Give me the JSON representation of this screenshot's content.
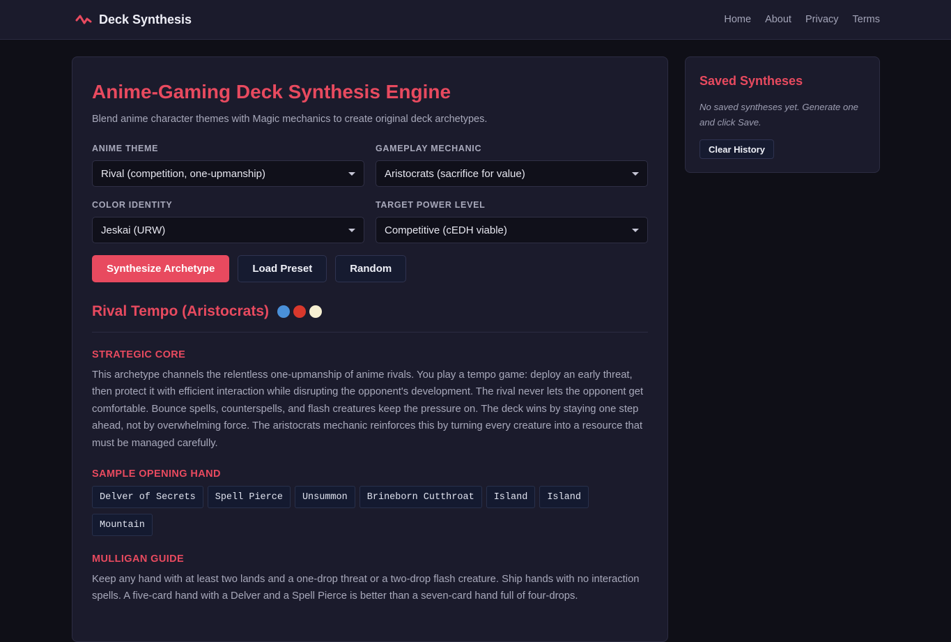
{
  "header": {
    "brand": "Deck Synthesis",
    "brand_icon": "pulse-icon",
    "nav": [
      "Home",
      "About",
      "Privacy",
      "Terms"
    ]
  },
  "main": {
    "title": "Anime-Gaming Deck Synthesis Engine",
    "subtitle": "Blend anime character themes with Magic mechanics to create original deck archetypes.",
    "fields": {
      "anime_theme": {
        "label": "Anime Theme",
        "value": "Rival (competition, one-upmanship)"
      },
      "gameplay_mechanic": {
        "label": "Gameplay Mechanic",
        "value": "Aristocrats (sacrifice for value)"
      },
      "color_identity": {
        "label": "Color Identity",
        "value": "Jeskai (URW)"
      },
      "power_level": {
        "label": "Target Power Level",
        "value": "Competitive (cEDH viable)"
      }
    },
    "buttons": {
      "synthesize": "Synthesize Archetype",
      "load_preset": "Load Preset",
      "random": "Random"
    },
    "result": {
      "title": "Rival Tempo (Aristocrats)",
      "color_pips": [
        "#4a90d9",
        "#d9382c",
        "#f6efd2"
      ],
      "strategic_core": {
        "title": "Strategic Core",
        "text": "This archetype channels the relentless one-upmanship of anime rivals. You play a tempo game: deploy an early threat, then protect it with efficient interaction while disrupting the opponent's development. The rival never lets the opponent get comfortable. Bounce spells, counterspells, and flash creatures keep the pressure on. The deck wins by staying one step ahead, not by overwhelming force. The aristocrats mechanic reinforces this by turning every creature into a resource that must be managed carefully."
      },
      "opening_hand": {
        "title": "Sample Opening Hand",
        "cards": [
          "Delver of Secrets",
          "Spell Pierce",
          "Unsummon",
          "Brineborn Cutthroat",
          "Island",
          "Island",
          "Mountain"
        ]
      },
      "mulligan": {
        "title": "Mulligan Guide",
        "text": "Keep any hand with at least two lands and a one-drop threat or a two-drop flash creature. Ship hands with no interaction spells. A five-card hand with a Delver and a Spell Pierce is better than a seven-card hand full of four-drops."
      }
    }
  },
  "sidebar": {
    "title": "Saved Syntheses",
    "empty_text": "No saved syntheses yet. Generate one and click Save.",
    "clear_button": "Clear History"
  },
  "colors": {
    "accent": "#e84a5f",
    "background": "#0f0f17",
    "panel": "#1b1b2c"
  }
}
